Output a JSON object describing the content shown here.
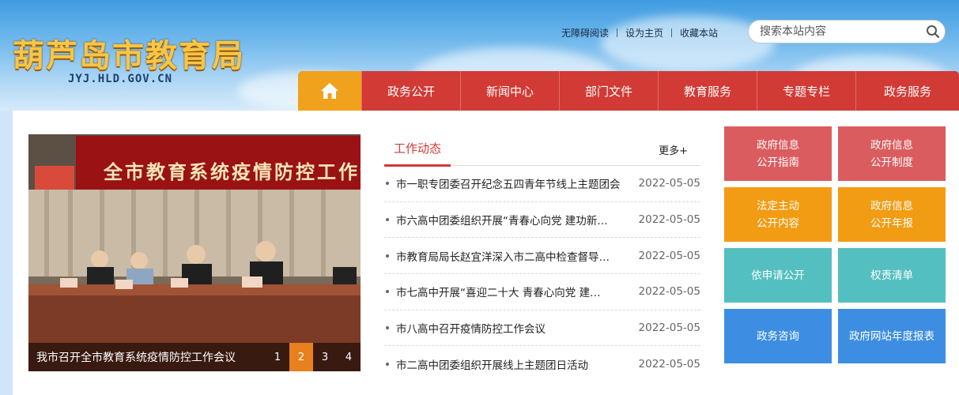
{
  "site": {
    "title": "葫芦岛市教育局",
    "url": "JYJ.HLD.GOV.CN"
  },
  "top_links": [
    "无障碍阅读",
    "设为主页",
    "收藏本站"
  ],
  "search": {
    "placeholder": "搜索本站内容"
  },
  "nav": {
    "home_icon": "home-icon",
    "items": [
      "政务公开",
      "新闻中心",
      "部门文件",
      "教育服务",
      "专题专栏",
      "政务服务"
    ]
  },
  "slider": {
    "banner_text": "全市教育系统疫情防控工作会",
    "caption": "我市召开全市教育系统疫情防控工作会议",
    "pages": [
      "1",
      "2",
      "3",
      "4"
    ],
    "active_page": 2
  },
  "news": {
    "tab": "工作动态",
    "more": "更多+",
    "items": [
      {
        "title": "市一职专团委召开纪念五四青年节线上主题团会",
        "date": "2022-05-05"
      },
      {
        "title": "市六高中团委组织开展“青春心向党 建功新…",
        "date": "2022-05-05"
      },
      {
        "title": "市教育局局长赵宜洋深入市二高中检查督导…",
        "date": "2022-05-05"
      },
      {
        "title": "市七高中开展“喜迎二十大 青春心向党 建…",
        "date": "2022-05-05"
      },
      {
        "title": "市八高中召开疫情防控工作会议",
        "date": "2022-05-05"
      },
      {
        "title": "市二高中团委组织开展线上主题团日活动",
        "date": "2022-05-05"
      }
    ]
  },
  "quick_links": [
    {
      "lines": [
        "政府信息",
        "公开指南"
      ],
      "color": "#db5c5f"
    },
    {
      "lines": [
        "政府信息",
        "公开制度"
      ],
      "color": "#db5c5f"
    },
    {
      "lines": [
        "法定主动",
        "公开内容"
      ],
      "color": "#f29c13"
    },
    {
      "lines": [
        "政府信息",
        "公开年报"
      ],
      "color": "#f29c13"
    },
    {
      "lines": [
        "依申请公开"
      ],
      "color": "#54bfc0"
    },
    {
      "lines": [
        "权责清单"
      ],
      "color": "#54bfc0"
    },
    {
      "lines": [
        "政务咨询"
      ],
      "color": "#3d8ee2"
    },
    {
      "lines": [
        "政府网站年度报表"
      ],
      "color": "#3d8ee2"
    }
  ]
}
